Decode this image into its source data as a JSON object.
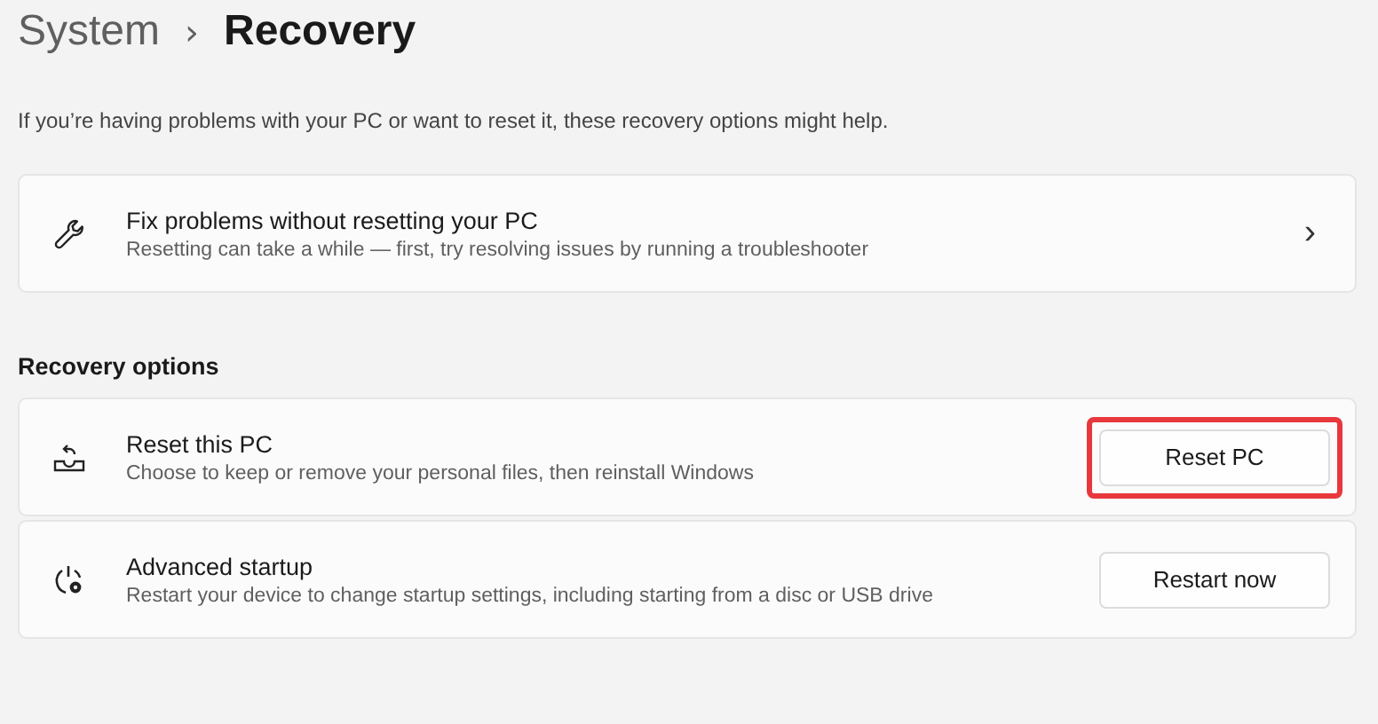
{
  "breadcrumb": {
    "parent": "System",
    "separator": "›",
    "current": "Recovery"
  },
  "description": "If you’re having problems with your PC or want to reset it, these recovery options might help.",
  "top_card": {
    "kind": "link",
    "title": "Fix problems without resetting your PC",
    "subtitle": "Resetting can take a while — first, try resolving issues by running a troubleshooter",
    "chevron": "›"
  },
  "section_heading": "Recovery options",
  "options": [
    {
      "kind": "button",
      "title": "Reset this PC",
      "subtitle": "Choose to keep or remove your personal files, then reinstall Windows",
      "button": "Reset PC",
      "highlighted": true
    },
    {
      "kind": "button",
      "title": "Advanced startup",
      "subtitle": "Restart your device to change startup settings, including starting from a disc or USB drive",
      "button": "Restart now",
      "highlighted": false
    }
  ]
}
